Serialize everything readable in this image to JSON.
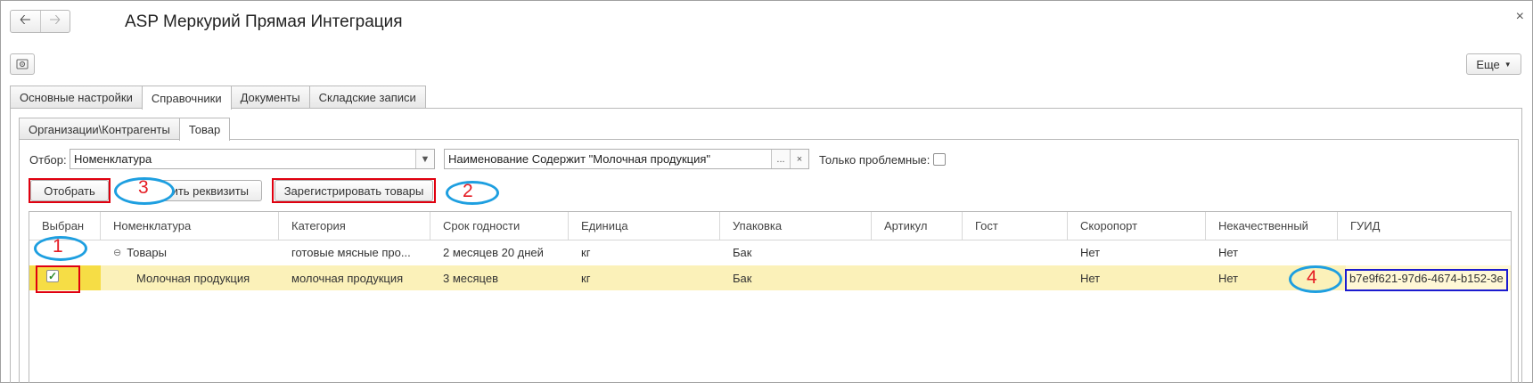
{
  "window": {
    "title": "ASP Меркурий Прямая Интеграция"
  },
  "toolbar": {
    "more_label": "Еще"
  },
  "main_tabs": [
    {
      "label": "Основные настройки"
    },
    {
      "label": "Справочники"
    },
    {
      "label": "Документы"
    },
    {
      "label": "Складские записи"
    }
  ],
  "sub_tabs": [
    {
      "label": "Организации\\Контрагенты"
    },
    {
      "label": "Товар"
    }
  ],
  "filter": {
    "label": "Отбор:",
    "field_value": "Номенклатура",
    "condition_value": "Наименование Содержит \"Молочная продукция\"",
    "problem_only_label": "Только проблемные:"
  },
  "buttons": {
    "select": "Отобрать",
    "fill_attrs": "ить реквизиты",
    "register": "Зарегистрировать товары"
  },
  "annotations": {
    "m1": "1",
    "m2": "2",
    "m3": "3",
    "m4": "4"
  },
  "table": {
    "columns": [
      "Выбран",
      "Номенклатура",
      "Категория",
      "Срок годности",
      "Единица",
      "Упаковка",
      "Артикул",
      "Гост",
      "Скоропорт",
      "Некачественный",
      "ГУИД"
    ],
    "rows": [
      {
        "selected": "",
        "name": "Товары",
        "category": "готовые мясные про...",
        "shelf_life": "2 месяцев 20 дней",
        "unit": "кг",
        "package": "Бак",
        "article": "",
        "gost": "",
        "perishable": "Нет",
        "low_quality": "Нет",
        "guid": ""
      },
      {
        "selected": "checked",
        "name": "Молочная продукция",
        "category": "молочная продукция",
        "shelf_life": "3 месяцев",
        "unit": "кг",
        "package": "Бак",
        "article": "",
        "gost": "",
        "perishable": "Нет",
        "low_quality": "Нет",
        "guid": "b7e9f621-97d6-4674-b152-3e"
      }
    ]
  },
  "colors": {
    "selected_row": "#fbf1b9",
    "highlight_red": "#e0000f",
    "ellipse_blue": "#1e9fe0",
    "guid_box_blue": "#1b1bd0"
  },
  "icons": [
    "back-arrow-icon",
    "forward-arrow-icon",
    "close-icon",
    "settings-icon",
    "dropdown-arrow-icon",
    "ellipsis-icon",
    "clear-icon",
    "collapse-icon",
    "checkbox-checked-icon"
  ]
}
